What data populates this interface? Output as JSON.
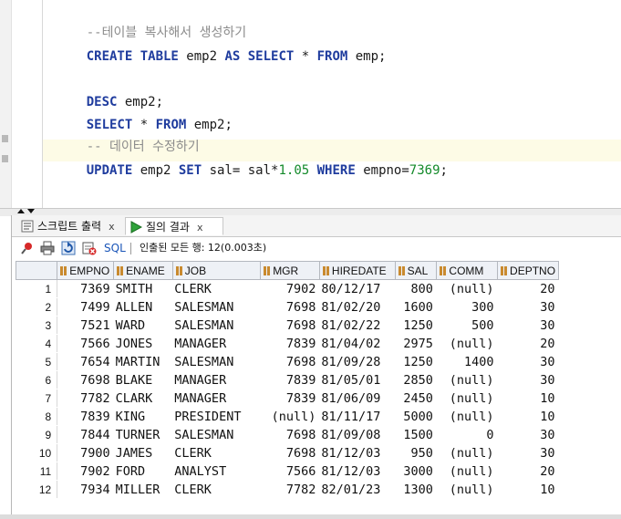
{
  "editor": {
    "line1_comment": "--테이블 복사해서 생성하기",
    "line2": {
      "kw1": "CREATE TABLE",
      "p1": " emp2 ",
      "kw2": "AS SELECT",
      "p2": " * ",
      "kw3": "FROM",
      "p3": " emp;"
    },
    "line3": {
      "kw1": "DESC",
      "p1": " emp2;"
    },
    "line4": {
      "kw1": "SELECT",
      "p1": " * ",
      "kw2": "FROM",
      "p2": " emp2;"
    },
    "line5_comment": "-- 데이터 수정하기",
    "line6": {
      "kw1": "UPDATE",
      "p1": " emp2 ",
      "kw2": "SET",
      "p2": " sal= sal*",
      "n1": "1.05",
      "p3": " ",
      "kw3": "WHERE",
      "p4": " empno=",
      "n2": "7369",
      "p5": ";"
    }
  },
  "tabs": {
    "script_output": "스크립트 출력",
    "query_result": "질의 결과",
    "close_glyph": "x"
  },
  "toolbar": {
    "sql_label": "SQL",
    "separator": "|",
    "status": "인출된 모든 행: 12(0.003초)"
  },
  "grid": {
    "columns": [
      "EMPNO",
      "ENAME",
      "JOB",
      "MGR",
      "HIREDATE",
      "SAL",
      "COMM",
      "DEPTNO"
    ],
    "rows": [
      [
        "1",
        "7369",
        "SMITH",
        "CLERK",
        "7902",
        "80/12/17",
        "800",
        "(null)",
        "20"
      ],
      [
        "2",
        "7499",
        "ALLEN",
        "SALESMAN",
        "7698",
        "81/02/20",
        "1600",
        "300",
        "30"
      ],
      [
        "3",
        "7521",
        "WARD",
        "SALESMAN",
        "7698",
        "81/02/22",
        "1250",
        "500",
        "30"
      ],
      [
        "4",
        "7566",
        "JONES",
        "MANAGER",
        "7839",
        "81/04/02",
        "2975",
        "(null)",
        "20"
      ],
      [
        "5",
        "7654",
        "MARTIN",
        "SALESMAN",
        "7698",
        "81/09/28",
        "1250",
        "1400",
        "30"
      ],
      [
        "6",
        "7698",
        "BLAKE",
        "MANAGER",
        "7839",
        "81/05/01",
        "2850",
        "(null)",
        "30"
      ],
      [
        "7",
        "7782",
        "CLARK",
        "MANAGER",
        "7839",
        "81/06/09",
        "2450",
        "(null)",
        "10"
      ],
      [
        "8",
        "7839",
        "KING",
        "PRESIDENT",
        "(null)",
        "81/11/17",
        "5000",
        "(null)",
        "10"
      ],
      [
        "9",
        "7844",
        "TURNER",
        "SALESMAN",
        "7698",
        "81/09/08",
        "1500",
        "0",
        "30"
      ],
      [
        "10",
        "7900",
        "JAMES",
        "CLERK",
        "7698",
        "81/12/03",
        "950",
        "(null)",
        "30"
      ],
      [
        "11",
        "7902",
        "FORD",
        "ANALYST",
        "7566",
        "81/12/03",
        "3000",
        "(null)",
        "20"
      ],
      [
        "12",
        "7934",
        "MILLER",
        "CLERK",
        "7782",
        "82/01/23",
        "1300",
        "(null)",
        "10"
      ]
    ]
  },
  "icons": {
    "pin": "pin-icon",
    "print": "print-icon",
    "refresh": "refresh-icon",
    "clear": "clear-icon",
    "run": "run-icon",
    "script": "script-icon"
  },
  "colors": {
    "keyword": "#1f3c9e",
    "comment": "#8c8c8c",
    "number": "#138a2a",
    "current_line": "#fdfbe6",
    "sql_link": "#1a55b8"
  }
}
